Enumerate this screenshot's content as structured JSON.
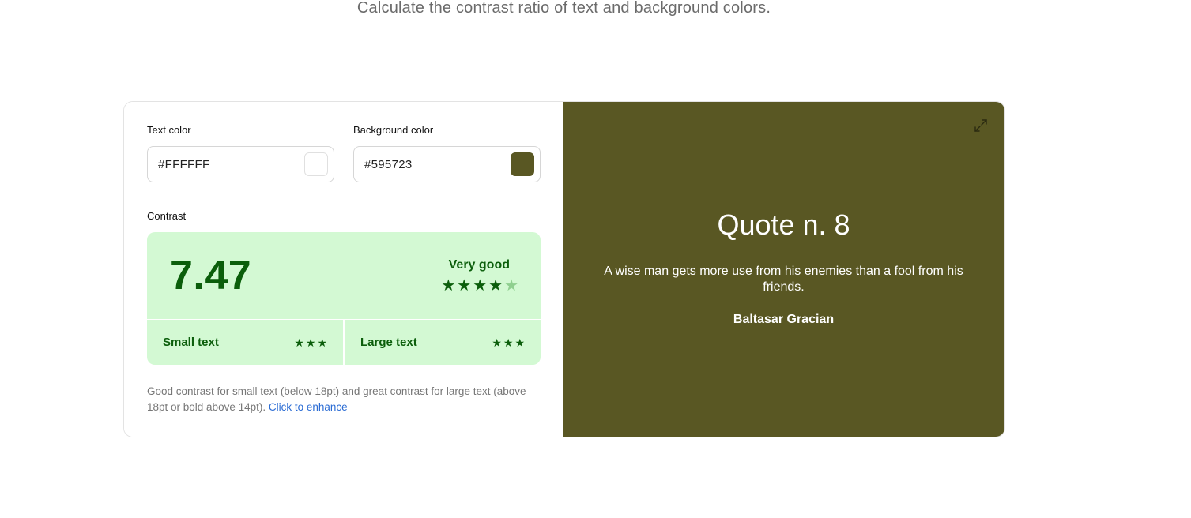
{
  "header": {
    "subtitle": "Calculate the contrast ratio of text and background colors."
  },
  "inputs": {
    "text_color": {
      "label": "Text color",
      "value": "#FFFFFF",
      "swatch": "#FFFFFF"
    },
    "background_color": {
      "label": "Background color",
      "value": "#595723",
      "swatch": "#595723"
    }
  },
  "contrast": {
    "label": "Contrast",
    "ratio": "7.47",
    "rating_label": "Very good",
    "stars_filled": 4,
    "stars_total": 5,
    "small_text": {
      "label": "Small text",
      "stars": 3
    },
    "large_text": {
      "label": "Large text",
      "stars": 3
    }
  },
  "note": {
    "text": "Good contrast for small text (below 18pt) and great contrast for large text (above 18pt or bold above 14pt).",
    "link": "Click to enhance"
  },
  "preview": {
    "title": "Quote n. 8",
    "quote": "A wise man gets more use from his enemies than a fool from his friends.",
    "author": "Baltasar Gracian",
    "expand_icon": "expand-icon"
  },
  "colors": {
    "accent_bg": "#d3f9d3",
    "accent_text": "#0b5e0b",
    "star_empty": "#8fcf8f",
    "preview_bg": "#595723",
    "preview_text": "#FFFFFF"
  }
}
